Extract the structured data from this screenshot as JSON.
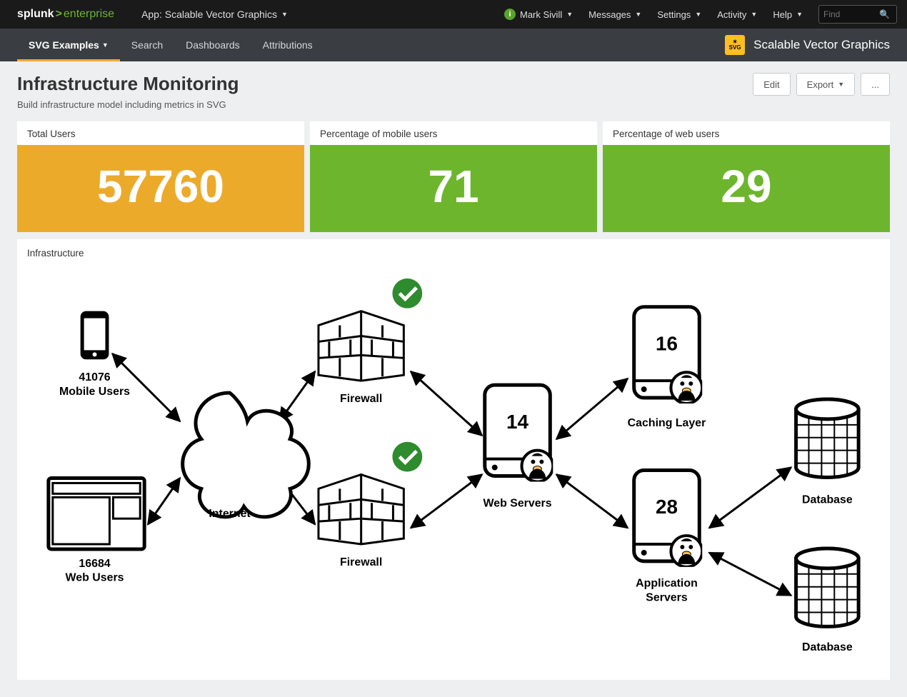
{
  "brand": {
    "left": "splunk",
    "right": "enterprise"
  },
  "app_switch": "App: Scalable Vector Graphics",
  "topbar": {
    "user": "Mark Sivill",
    "messages": "Messages",
    "settings": "Settings",
    "activity": "Activity",
    "help": "Help",
    "find_placeholder": "Find"
  },
  "appbar": {
    "tabs": [
      "SVG Examples",
      "Search",
      "Dashboards",
      "Attributions"
    ],
    "active_index": 0,
    "title": "Scalable Vector Graphics"
  },
  "page": {
    "title": "Infrastructure Monitoring",
    "subtitle": "Build infrastructure model including metrics in SVG",
    "edit": "Edit",
    "export": "Export",
    "more": "..."
  },
  "metrics": [
    {
      "label": "Total Users",
      "value": "57760",
      "color": "orange"
    },
    {
      "label": "Percentage of mobile users",
      "value": "71",
      "color": "green"
    },
    {
      "label": "Percentage of web users",
      "value": "29",
      "color": "green"
    }
  ],
  "infra": {
    "heading": "Infrastructure",
    "mobile_users": {
      "count": "41076",
      "label": "Mobile Users"
    },
    "web_users": {
      "count": "16684",
      "label": "Web Users"
    },
    "internet": "Internet",
    "firewall": "Firewall",
    "web_servers": {
      "count": "14",
      "label": "Web Servers"
    },
    "caching": {
      "count": "16",
      "label": "Caching Layer"
    },
    "appservers": {
      "count": "28",
      "label": "Application",
      "label2": "Servers"
    },
    "database": "Database"
  }
}
